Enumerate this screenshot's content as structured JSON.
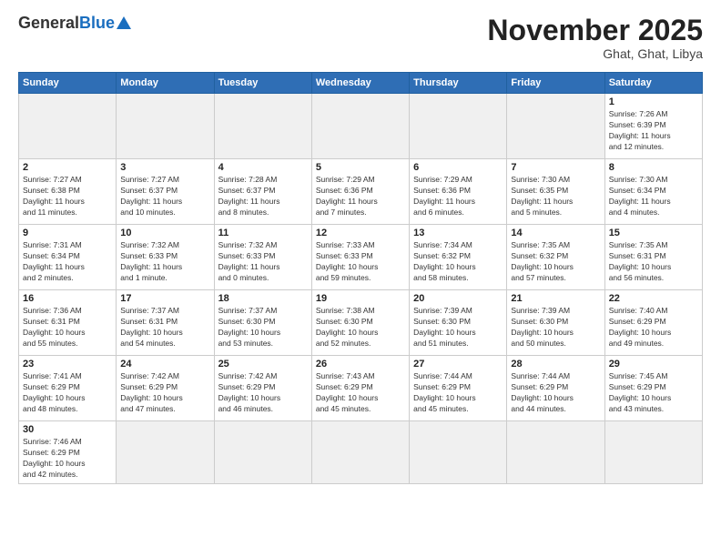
{
  "header": {
    "logo_general": "General",
    "logo_blue": "Blue",
    "logo_subtitle": "",
    "title": "November 2025",
    "subtitle": "Ghat, Ghat, Libya"
  },
  "weekdays": [
    "Sunday",
    "Monday",
    "Tuesday",
    "Wednesday",
    "Thursday",
    "Friday",
    "Saturday"
  ],
  "weeks": [
    [
      {
        "day": "",
        "info": ""
      },
      {
        "day": "",
        "info": ""
      },
      {
        "day": "",
        "info": ""
      },
      {
        "day": "",
        "info": ""
      },
      {
        "day": "",
        "info": ""
      },
      {
        "day": "",
        "info": ""
      },
      {
        "day": "1",
        "info": "Sunrise: 7:26 AM\nSunset: 6:39 PM\nDaylight: 11 hours\nand 12 minutes."
      }
    ],
    [
      {
        "day": "2",
        "info": "Sunrise: 7:27 AM\nSunset: 6:38 PM\nDaylight: 11 hours\nand 11 minutes."
      },
      {
        "day": "3",
        "info": "Sunrise: 7:27 AM\nSunset: 6:37 PM\nDaylight: 11 hours\nand 10 minutes."
      },
      {
        "day": "4",
        "info": "Sunrise: 7:28 AM\nSunset: 6:37 PM\nDaylight: 11 hours\nand 8 minutes."
      },
      {
        "day": "5",
        "info": "Sunrise: 7:29 AM\nSunset: 6:36 PM\nDaylight: 11 hours\nand 7 minutes."
      },
      {
        "day": "6",
        "info": "Sunrise: 7:29 AM\nSunset: 6:36 PM\nDaylight: 11 hours\nand 6 minutes."
      },
      {
        "day": "7",
        "info": "Sunrise: 7:30 AM\nSunset: 6:35 PM\nDaylight: 11 hours\nand 5 minutes."
      },
      {
        "day": "8",
        "info": "Sunrise: 7:30 AM\nSunset: 6:34 PM\nDaylight: 11 hours\nand 4 minutes."
      }
    ],
    [
      {
        "day": "9",
        "info": "Sunrise: 7:31 AM\nSunset: 6:34 PM\nDaylight: 11 hours\nand 2 minutes."
      },
      {
        "day": "10",
        "info": "Sunrise: 7:32 AM\nSunset: 6:33 PM\nDaylight: 11 hours\nand 1 minute."
      },
      {
        "day": "11",
        "info": "Sunrise: 7:32 AM\nSunset: 6:33 PM\nDaylight: 11 hours\nand 0 minutes."
      },
      {
        "day": "12",
        "info": "Sunrise: 7:33 AM\nSunset: 6:33 PM\nDaylight: 10 hours\nand 59 minutes."
      },
      {
        "day": "13",
        "info": "Sunrise: 7:34 AM\nSunset: 6:32 PM\nDaylight: 10 hours\nand 58 minutes."
      },
      {
        "day": "14",
        "info": "Sunrise: 7:35 AM\nSunset: 6:32 PM\nDaylight: 10 hours\nand 57 minutes."
      },
      {
        "day": "15",
        "info": "Sunrise: 7:35 AM\nSunset: 6:31 PM\nDaylight: 10 hours\nand 56 minutes."
      }
    ],
    [
      {
        "day": "16",
        "info": "Sunrise: 7:36 AM\nSunset: 6:31 PM\nDaylight: 10 hours\nand 55 minutes."
      },
      {
        "day": "17",
        "info": "Sunrise: 7:37 AM\nSunset: 6:31 PM\nDaylight: 10 hours\nand 54 minutes."
      },
      {
        "day": "18",
        "info": "Sunrise: 7:37 AM\nSunset: 6:30 PM\nDaylight: 10 hours\nand 53 minutes."
      },
      {
        "day": "19",
        "info": "Sunrise: 7:38 AM\nSunset: 6:30 PM\nDaylight: 10 hours\nand 52 minutes."
      },
      {
        "day": "20",
        "info": "Sunrise: 7:39 AM\nSunset: 6:30 PM\nDaylight: 10 hours\nand 51 minutes."
      },
      {
        "day": "21",
        "info": "Sunrise: 7:39 AM\nSunset: 6:30 PM\nDaylight: 10 hours\nand 50 minutes."
      },
      {
        "day": "22",
        "info": "Sunrise: 7:40 AM\nSunset: 6:29 PM\nDaylight: 10 hours\nand 49 minutes."
      }
    ],
    [
      {
        "day": "23",
        "info": "Sunrise: 7:41 AM\nSunset: 6:29 PM\nDaylight: 10 hours\nand 48 minutes."
      },
      {
        "day": "24",
        "info": "Sunrise: 7:42 AM\nSunset: 6:29 PM\nDaylight: 10 hours\nand 47 minutes."
      },
      {
        "day": "25",
        "info": "Sunrise: 7:42 AM\nSunset: 6:29 PM\nDaylight: 10 hours\nand 46 minutes."
      },
      {
        "day": "26",
        "info": "Sunrise: 7:43 AM\nSunset: 6:29 PM\nDaylight: 10 hours\nand 45 minutes."
      },
      {
        "day": "27",
        "info": "Sunrise: 7:44 AM\nSunset: 6:29 PM\nDaylight: 10 hours\nand 45 minutes."
      },
      {
        "day": "28",
        "info": "Sunrise: 7:44 AM\nSunset: 6:29 PM\nDaylight: 10 hours\nand 44 minutes."
      },
      {
        "day": "29",
        "info": "Sunrise: 7:45 AM\nSunset: 6:29 PM\nDaylight: 10 hours\nand 43 minutes."
      }
    ],
    [
      {
        "day": "30",
        "info": "Sunrise: 7:46 AM\nSunset: 6:29 PM\nDaylight: 10 hours\nand 42 minutes."
      },
      {
        "day": "",
        "info": ""
      },
      {
        "day": "",
        "info": ""
      },
      {
        "day": "",
        "info": ""
      },
      {
        "day": "",
        "info": ""
      },
      {
        "day": "",
        "info": ""
      },
      {
        "day": "",
        "info": ""
      }
    ]
  ]
}
